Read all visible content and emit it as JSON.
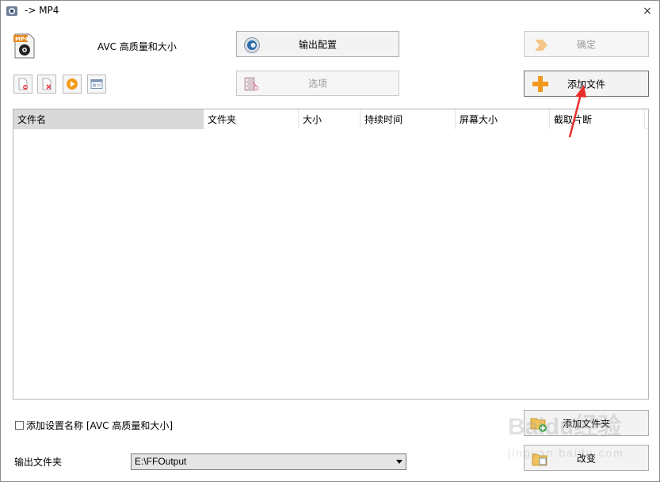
{
  "window": {
    "title": "-> MP4",
    "close_label": "×"
  },
  "profile": {
    "label": "AVC 高质量和大小"
  },
  "buttons": {
    "output_config": "输出配置",
    "ok": "确定",
    "options": "选项",
    "add_file": "添加文件",
    "add_folder": "添加文件夹",
    "change": "改变"
  },
  "list": {
    "columns": [
      "文件名",
      "文件夹",
      "大小",
      "持续时间",
      "屏幕大小",
      "截取片断"
    ]
  },
  "checkbox": {
    "label": "添加设置名称 [AVC 高质量和大小]",
    "checked": false
  },
  "output": {
    "label": "输出文件夹",
    "value": "E:\\FFOutput"
  },
  "watermark": {
    "line1": "Baidu经验",
    "line2": "jingyan.baidu.com"
  },
  "colors": {
    "accent_orange": "#f39a1e",
    "annotation_red": "#e8302b"
  }
}
